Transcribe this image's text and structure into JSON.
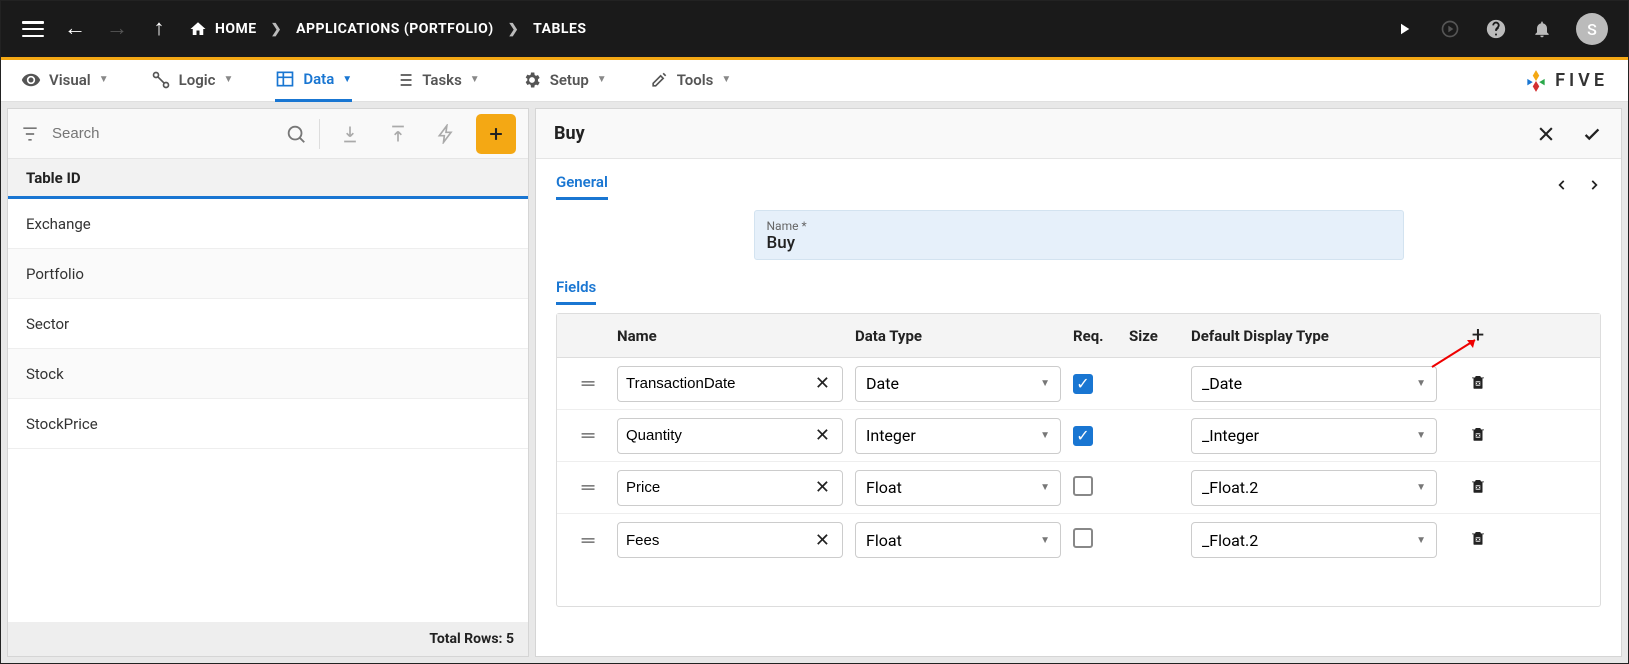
{
  "topbar": {
    "home": "HOME",
    "applications": "APPLICATIONS (PORTFOLIO)",
    "tables": "TABLES",
    "avatar": "S"
  },
  "menu": {
    "visual": "Visual",
    "logic": "Logic",
    "data": "Data",
    "tasks": "Tasks",
    "setup": "Setup",
    "tools": "Tools",
    "brand": "FIVE"
  },
  "left": {
    "search_placeholder": "Search",
    "header": "Table ID",
    "rows": [
      "Exchange",
      "Portfolio",
      "Sector",
      "Stock",
      "StockPrice"
    ],
    "footer_label": "Total Rows:",
    "footer_count": "5"
  },
  "right": {
    "title": "Buy",
    "tab_general": "General",
    "name_label": "Name *",
    "name_value": "Buy",
    "subtab_fields": "Fields",
    "columns": {
      "name": "Name",
      "type": "Data Type",
      "req": "Req.",
      "size": "Size",
      "disp": "Default Display Type"
    },
    "fields": [
      {
        "name": "TransactionDate",
        "type": "Date",
        "req": true,
        "disp": "_Date"
      },
      {
        "name": "Quantity",
        "type": "Integer",
        "req": true,
        "disp": "_Integer"
      },
      {
        "name": "Price",
        "type": "Float",
        "req": false,
        "disp": "_Float.2"
      },
      {
        "name": "Fees",
        "type": "Float",
        "req": false,
        "disp": "_Float.2"
      }
    ]
  }
}
